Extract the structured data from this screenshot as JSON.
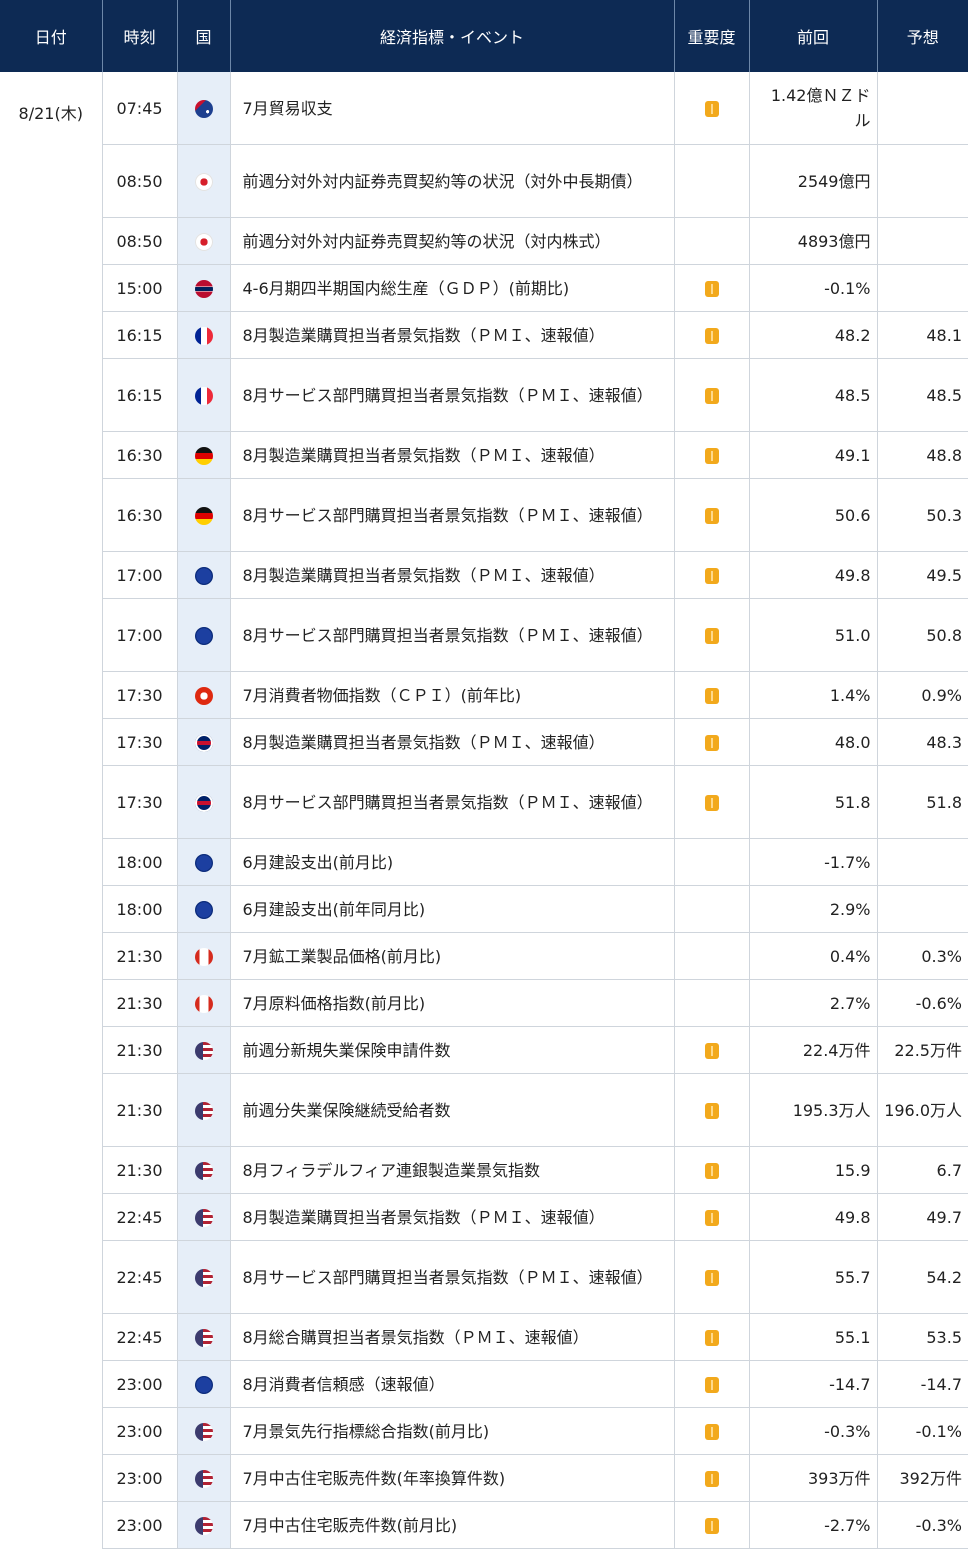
{
  "headers": {
    "date": "日付",
    "time": "時刻",
    "country": "国",
    "event": "経済指標・イベント",
    "importance": "重要度",
    "previous": "前回",
    "forecast": "予想"
  },
  "date": "8/21(木)",
  "rows": [
    {
      "time": "07:45",
      "flag": "australia-flag-icon",
      "event": "7月貿易収支",
      "important": true,
      "previous": "1.42億ＮＺドル",
      "forecast": ""
    },
    {
      "time": "08:50",
      "flag": "japan-flag-icon",
      "event": "前週分対外対内証券売買契約等の状況（対外中長期債）",
      "important": false,
      "previous": "2549億円",
      "forecast": ""
    },
    {
      "time": "08:50",
      "flag": "japan-flag-icon",
      "event": "前週分対外対内証券売買契約等の状況（対内株式）",
      "important": false,
      "previous": "4893億円",
      "forecast": ""
    },
    {
      "time": "15:00",
      "flag": "norway-flag-icon",
      "event": "4-6月期四半期国内総生産（ＧＤＰ）(前期比)",
      "important": true,
      "previous": "-0.1%",
      "forecast": ""
    },
    {
      "time": "16:15",
      "flag": "france-flag-icon",
      "event": "8月製造業購買担当者景気指数（ＰＭＩ、速報値）",
      "important": true,
      "previous": "48.2",
      "forecast": "48.1"
    },
    {
      "time": "16:15",
      "flag": "france-flag-icon",
      "event": "8月サービス部門購買担当者景気指数（ＰＭＩ、速報値）",
      "important": true,
      "previous": "48.5",
      "forecast": "48.5"
    },
    {
      "time": "16:30",
      "flag": "germany-flag-icon",
      "event": "8月製造業購買担当者景気指数（ＰＭＩ、速報値）",
      "important": true,
      "previous": "49.1",
      "forecast": "48.8"
    },
    {
      "time": "16:30",
      "flag": "germany-flag-icon",
      "event": "8月サービス部門購買担当者景気指数（ＰＭＩ、速報値）",
      "important": true,
      "previous": "50.6",
      "forecast": "50.3"
    },
    {
      "time": "17:00",
      "flag": "eu-flag-icon",
      "event": "8月製造業購買担当者景気指数（ＰＭＩ、速報値）",
      "important": true,
      "previous": "49.8",
      "forecast": "49.5"
    },
    {
      "time": "17:00",
      "flag": "eu-flag-icon",
      "event": "8月サービス部門購買担当者景気指数（ＰＭＩ、速報値）",
      "important": true,
      "previous": "51.0",
      "forecast": "50.8"
    },
    {
      "time": "17:30",
      "flag": "hongkong-flag-icon",
      "event": "7月消費者物価指数（ＣＰＩ）(前年比)",
      "important": true,
      "previous": "1.4%",
      "forecast": "0.9%"
    },
    {
      "time": "17:30",
      "flag": "uk-flag-icon",
      "event": "8月製造業購買担当者景気指数（ＰＭＩ、速報値）",
      "important": true,
      "previous": "48.0",
      "forecast": "48.3"
    },
    {
      "time": "17:30",
      "flag": "uk-flag-icon",
      "event": "8月サービス部門購買担当者景気指数（ＰＭＩ、速報値）",
      "important": true,
      "previous": "51.8",
      "forecast": "51.8"
    },
    {
      "time": "18:00",
      "flag": "eu-flag-icon",
      "event": "6月建設支出(前月比)",
      "important": false,
      "previous": "-1.7%",
      "forecast": ""
    },
    {
      "time": "18:00",
      "flag": "eu-flag-icon",
      "event": "6月建設支出(前年同月比)",
      "important": false,
      "previous": "2.9%",
      "forecast": ""
    },
    {
      "time": "21:30",
      "flag": "canada-flag-icon",
      "event": "7月鉱工業製品価格(前月比)",
      "important": false,
      "previous": "0.4%",
      "forecast": "0.3%"
    },
    {
      "time": "21:30",
      "flag": "canada-flag-icon",
      "event": "7月原料価格指数(前月比)",
      "important": false,
      "previous": "2.7%",
      "forecast": "-0.6%"
    },
    {
      "time": "21:30",
      "flag": "usa-flag-icon",
      "event": "前週分新規失業保険申請件数",
      "important": true,
      "previous": "22.4万件",
      "forecast": "22.5万件"
    },
    {
      "time": "21:30",
      "flag": "usa-flag-icon",
      "event": "前週分失業保険継続受給者数",
      "important": true,
      "previous": "195.3万人",
      "forecast": "196.0万人"
    },
    {
      "time": "21:30",
      "flag": "usa-flag-icon",
      "event": "8月フィラデルフィア連銀製造業景気指数",
      "important": true,
      "previous": "15.9",
      "forecast": "6.7"
    },
    {
      "time": "22:45",
      "flag": "usa-flag-icon",
      "event": "8月製造業購買担当者景気指数（ＰＭＩ、速報値）",
      "important": true,
      "previous": "49.8",
      "forecast": "49.7"
    },
    {
      "time": "22:45",
      "flag": "usa-flag-icon",
      "event": "8月サービス部門購買担当者景気指数（ＰＭＩ、速報値）",
      "important": true,
      "previous": "55.7",
      "forecast": "54.2"
    },
    {
      "time": "22:45",
      "flag": "usa-flag-icon",
      "event": "8月総合購買担当者景気指数（ＰＭＩ、速報値）",
      "important": true,
      "previous": "55.1",
      "forecast": "53.5"
    },
    {
      "time": "23:00",
      "flag": "eu-flag-icon",
      "event": "8月消費者信頼感（速報値）",
      "important": true,
      "previous": "-14.7",
      "forecast": "-14.7"
    },
    {
      "time": "23:00",
      "flag": "usa-flag-icon",
      "event": "7月景気先行指標総合指数(前月比)",
      "important": true,
      "previous": "-0.3%",
      "forecast": "-0.1%"
    },
    {
      "time": "23:00",
      "flag": "usa-flag-icon",
      "event": "7月中古住宅販売件数(年率換算件数)",
      "important": true,
      "previous": "393万件",
      "forecast": "392万件"
    },
    {
      "time": "23:00",
      "flag": "usa-flag-icon",
      "event": "7月中古住宅販売件数(前月比)",
      "important": true,
      "previous": "-2.7%",
      "forecast": "-0.3%"
    }
  ]
}
